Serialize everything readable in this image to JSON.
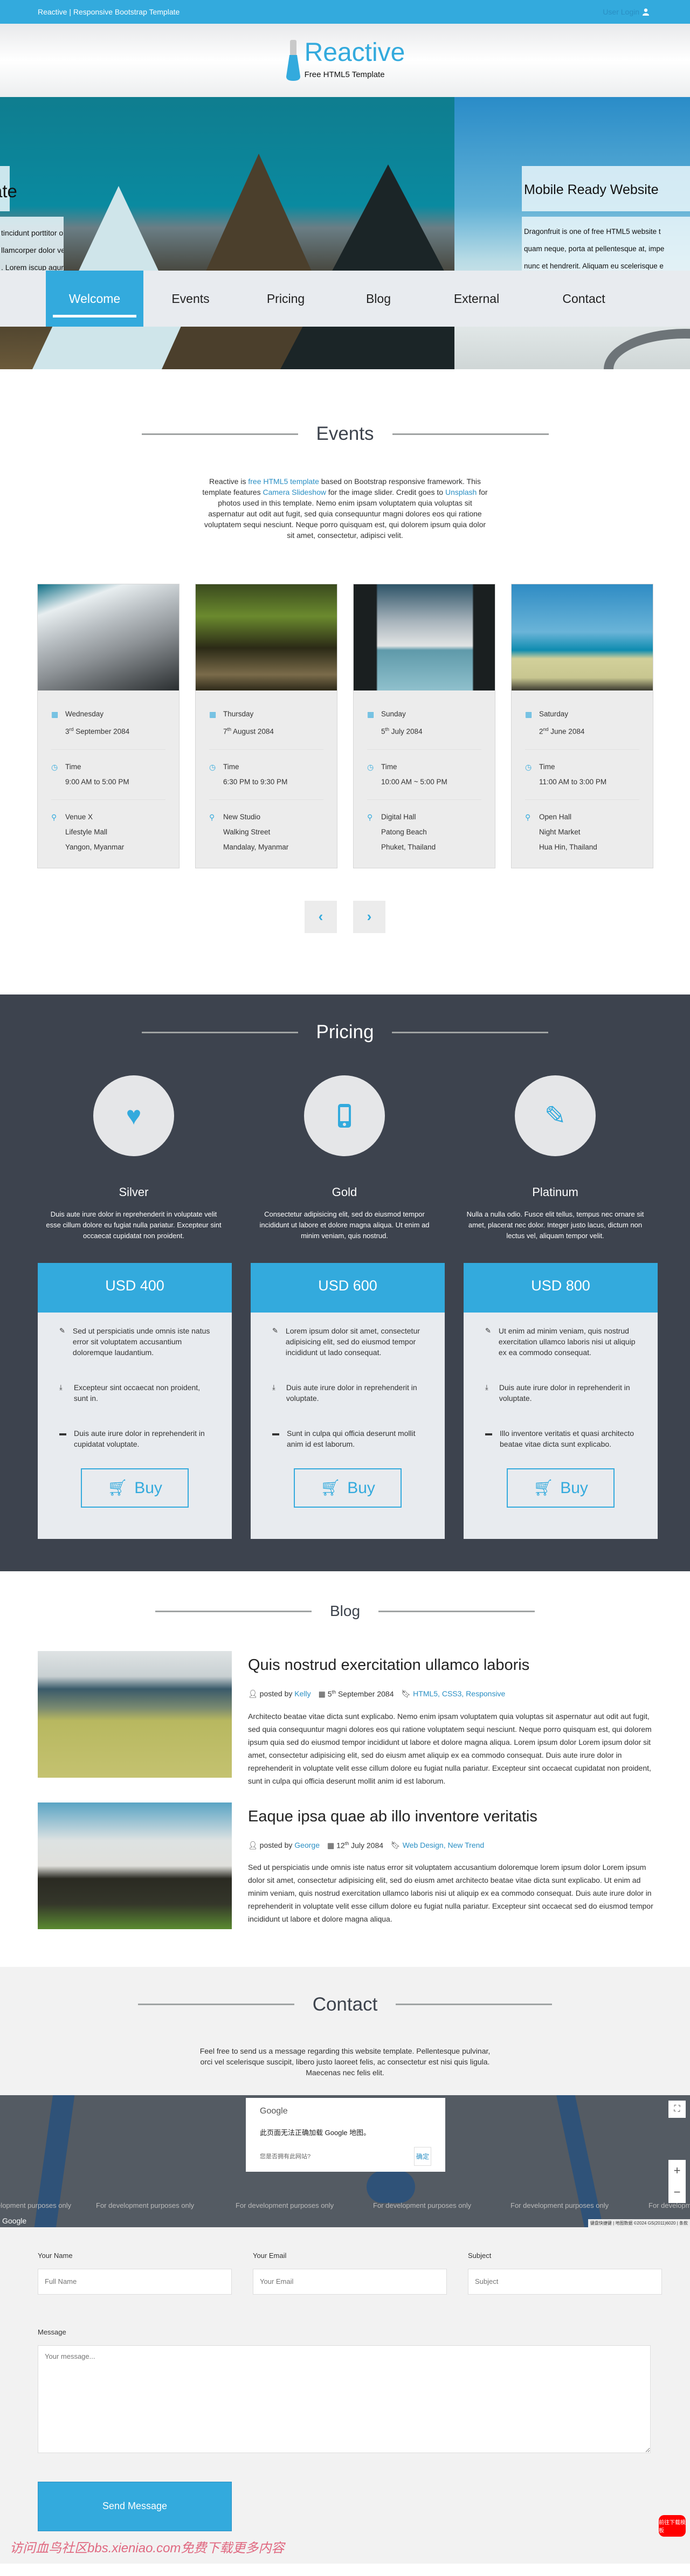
{
  "topbar": {
    "title": "Reactive | Responsive Bootstrap Template",
    "login": "User Login"
  },
  "brand": {
    "name": "Reactive",
    "tagline": "Free HTML5 Template"
  },
  "hero": {
    "slide1": {
      "title_fragment": "ate",
      "lines": [
        "tincidunt porttitor orci. Nulla consequat",
        "llamcorper dolor vehicula dolor",
        ". Lorem iscup agur condimentum"
      ]
    },
    "slide2": {
      "title": "Mobile Ready Website",
      "lines": [
        "Dragonfruit is one of free HTML5 website t",
        "quam neque, porta at pellentesque at, impe",
        "nunc et hendrerit. Aliquam eu scelerisque e"
      ]
    }
  },
  "nav": [
    "Welcome",
    "Events",
    "Pricing",
    "Blog",
    "External",
    "Contact"
  ],
  "events": {
    "title": "Events",
    "intro": {
      "t1": "Reactive is ",
      "l1": "free HTML5 template",
      "t2": " based on Bootstrap responsive framework. This template features ",
      "l2": "Camera Slideshow",
      "t3": " for the image slider. Credit goes to ",
      "l3": "Unsplash",
      "t4": " for photos used in this template. Nemo enim ipsam voluptatem quia voluptas sit aspernatur aut odit aut fugit, sed quia consequuntur magni dolores eos qui ratione voluptatem sequi nesciunt. Neque porro quisquam est, qui dolorem ipsum quia dolor sit amet, consectetur, adipisci velit."
    },
    "cards": [
      {
        "day": "Wednesday",
        "date_num": "3",
        "date_sup": "rd",
        "date_rest": " September 2084",
        "time_label": "Time",
        "time": "9:00 AM to 5:00 PM",
        "venue": "Venue X",
        "place": "Lifestyle Mall",
        "city": "Yangon, Myanmar"
      },
      {
        "day": "Thursday",
        "date_num": "7",
        "date_sup": "th",
        "date_rest": " August 2084",
        "time_label": "Time",
        "time": "6:30 PM to 9:30 PM",
        "venue": "New Studio",
        "place": "Walking Street",
        "city": "Mandalay, Myanmar"
      },
      {
        "day": "Sunday",
        "date_num": "5",
        "date_sup": "th",
        "date_rest": " July 2084",
        "time_label": "Time",
        "time": "10:00 AM ~ 5:00 PM",
        "venue": "Digital Hall",
        "place": "Patong Beach",
        "city": "Phuket, Thailand"
      },
      {
        "day": "Saturday",
        "date_num": "2",
        "date_sup": "nd",
        "date_rest": " June 2084",
        "time_label": "Time",
        "time": "11:00 AM to 3:00 PM",
        "venue": "Open Hall",
        "place": "Night Market",
        "city": "Hua Hin, Thailand"
      }
    ],
    "prev": "‹",
    "next": "›"
  },
  "pricing": {
    "title": "Pricing",
    "plans": [
      {
        "name": "Silver",
        "icon": "♥",
        "desc": "Duis aute irure dolor in reprehenderit in voluptate velit esse cillum dolore eu fugiat nulla pariatur. Excepteur sint occaecat cupidatat non proident."
      },
      {
        "name": "Gold",
        "icon": "▯",
        "desc": "Consectetur adipisicing elit, sed do eiusmod tempor incididunt ut labore et dolore magna aliqua. Ut enim ad minim veniam, quis nostrud."
      },
      {
        "name": "Platinum",
        "icon": "✎",
        "desc": "Nulla a nulla odio. Fusce elit tellus, tempus nec ornare sit amet, placerat nec dolor. Integer justo lacus, dictum non lectus vel, aliquam tempor velit."
      }
    ],
    "cards": [
      {
        "price": "USD 400",
        "features": [
          "Sed ut perspiciatis unde omnis iste natus error sit voluptatem accusantium doloremque laudantium.",
          "Excepteur sint occaecat non proident, sunt in.",
          "Duis aute irure dolor in reprehenderit in cupidatat voluptate."
        ]
      },
      {
        "price": "USD 600",
        "features": [
          "Lorem ipsum dolor sit amet, consectetur adipisicing elit, sed do eiusmod tempor incididunt ut lado consequat.",
          "Duis aute irure dolor in reprehenderit in voluptate.",
          "Sunt in culpa qui officia deserunt mollit anim id est laborum."
        ]
      },
      {
        "price": "USD 800",
        "features": [
          "Ut enim ad minim veniam, quis nostrud exercitation ullamco laboris nisi ut aliquip ex ea commodo consequat.",
          "Duis aute irure dolor in reprehenderit in voluptate.",
          "Illo inventore veritatis et quasi architecto beatae vitae dicta sunt explicabo."
        ]
      }
    ],
    "buy_label": "Buy"
  },
  "blog": {
    "title": "Blog",
    "posts": [
      {
        "title": "Quis nostrud exercitation ullamco laboris",
        "posted_by": "posted by",
        "author": "Kelly",
        "date_num": "5",
        "date_sup": "th",
        "date_rest": " September 2084",
        "tags": "HTML5, CSS3, Responsive",
        "body": "Architecto beatae vitae dicta sunt explicabo. Nemo enim ipsam voluptatem quia voluptas sit aspernatur aut odit aut fugit, sed quia consequuntur magni dolores eos qui ratione voluptatem sequi nesciunt. Neque porro quisquam est, qui dolorem ipsum quia sed do eiusmod tempor incididunt ut labore et dolore magna aliqua. Lorem ipsum dolor Lorem ipsum dolor sit amet, consectetur adipisicing elit, sed do eiusm amet aliquip ex ea commodo consequat. Duis aute irure dolor in reprehenderit in voluptate velit esse cillum dolore eu fugiat nulla pariatur. Excepteur sint occaecat cupidatat non proident, sunt in culpa qui officia deserunt mollit anim id est laborum."
      },
      {
        "title": "Eaque ipsa quae ab illo inventore veritatis",
        "posted_by": "posted by",
        "author": "George",
        "date_num": "12",
        "date_sup": "th",
        "date_rest": " July 2084",
        "tags": "Web Design, New Trend",
        "body": "Sed ut perspiciatis unde omnis iste natus error sit voluptatem accusantium doloremque lorem ipsum dolor Lorem ipsum dolor sit amet, consectetur adipisicing elit, sed do eiusm amet architecto beatae vitae dicta sunt explicabo. Ut enim ad minim veniam, quis nostrud exercitation ullamco laboris nisi ut aliquip ex ea commodo consequat. Duis aute irure dolor in reprehenderit in voluptate velit esse cillum dolore eu fugiat nulla pariatur. Excepteur sint occaecat sed do eiusmod tempor incididunt ut labore et dolore magna aliqua."
      }
    ]
  },
  "contact": {
    "title": "Contact",
    "intro": "Feel free to send us a message regarding this website template. Pellentesque pulvinar, orci vel scelerisque suscipit, libero justo laoreet felis, ac consectetur est nisi quis ligula. Maecenas nec felis elit.",
    "map": {
      "dialog_brand": "Google",
      "dialog_msg": "此页面无法正确加载 Google 地图。",
      "dialog_question": "您是否拥有此网站?",
      "dialog_ok": "确定",
      "dev_text": "For development purposes only",
      "logo": "Google",
      "attribution": "键盘快捷键 | 地图数据 ©2024 GS(2011)6020 | 条款"
    },
    "form": {
      "name_label": "Your Name",
      "name_placeholder": "Full Name",
      "email_label": "Your Email",
      "email_placeholder": "Your Email",
      "subject_label": "Subject",
      "subject_placeholder": "Subject",
      "message_label": "Message",
      "message_placeholder": "Your message...",
      "send_label": "Send Message"
    }
  },
  "overlay": {
    "watermark": "访问血鸟社区bbs.xieniao.com免费下载更多内容",
    "download_button": "前往下载模板"
  },
  "colors": {
    "accent": "#33aadd",
    "dark": "#3d434e",
    "download": "#ff0000"
  }
}
